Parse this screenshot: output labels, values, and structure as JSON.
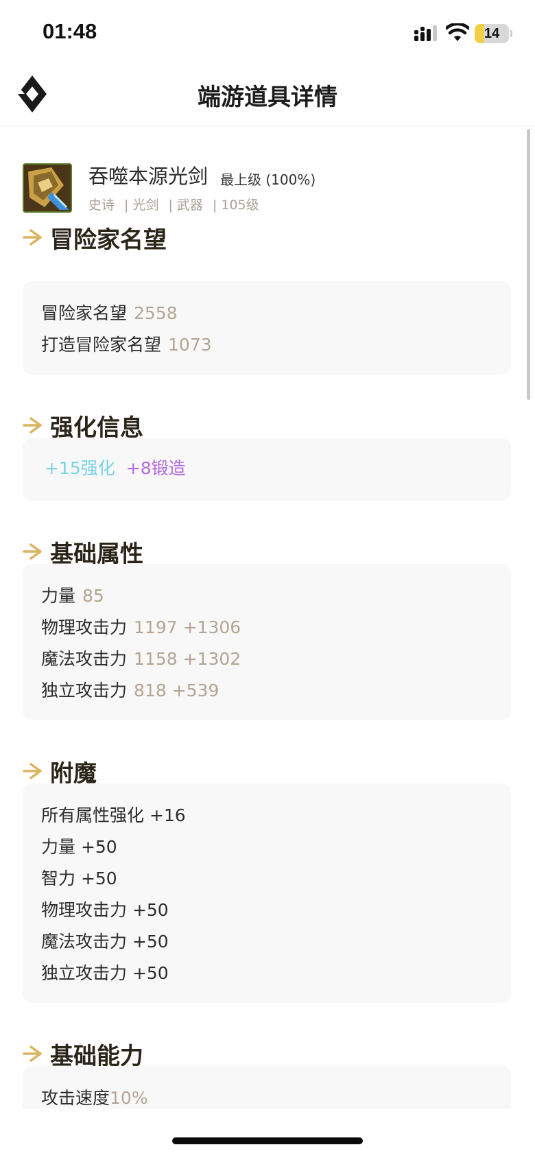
{
  "status_bar": {
    "time": "01:48",
    "battery": "14"
  },
  "nav": {
    "title": "端游道具详情"
  },
  "item": {
    "name": "吞噬本源光剑",
    "grade": "最上级 (100%)",
    "tags": [
      "史诗",
      "| 光剑",
      "| 武器",
      "| 105级"
    ]
  },
  "sections": {
    "reputation": {
      "title": "冒险家名望",
      "rows": [
        {
          "label": "冒险家名望",
          "value": "2558"
        },
        {
          "label": "打造冒险家名望",
          "value": "1073"
        }
      ]
    },
    "enhance": {
      "title": "强化信息",
      "enhance_text": "+15强化",
      "forge_text": "+8锻造"
    },
    "basic": {
      "title": "基础属性",
      "rows": [
        {
          "label": "力量",
          "value": "85"
        },
        {
          "label": "物理攻击力",
          "value": "1197 +1306"
        },
        {
          "label": "魔法攻击力",
          "value": "1158 +1302"
        },
        {
          "label": "独立攻击力",
          "value": "818 +539"
        }
      ]
    },
    "enchant": {
      "title": "附魔",
      "rows": [
        "所有属性强化 +16",
        "力量 +50",
        "智力 +50",
        "物理攻击力 +50",
        "魔法攻击力 +50",
        "独立攻击力 +50"
      ]
    },
    "ability": {
      "title": "基础能力",
      "rows": [
        {
          "label": "攻击速度",
          "value": "10%"
        }
      ]
    }
  },
  "colors": {
    "accent_gold": "#d9b35f",
    "value_gray": "#b3a591",
    "enhance_blue": "#78d2e6",
    "forge_purple": "#b26be3",
    "card_bg": "#f8f8f8"
  }
}
